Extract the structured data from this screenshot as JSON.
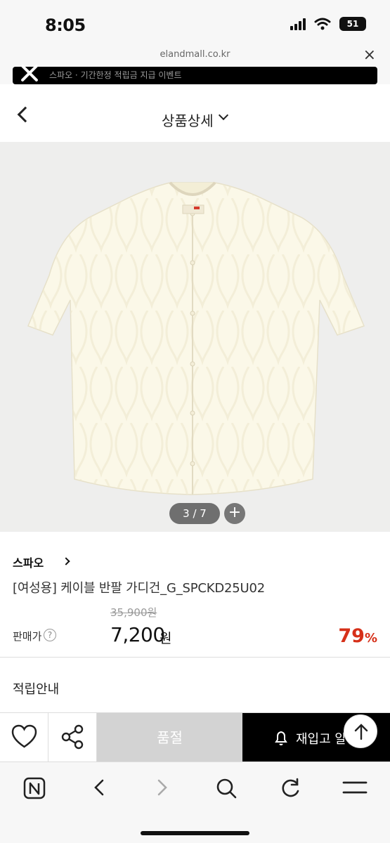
{
  "status_bar": {
    "time": "8:05",
    "battery": "51"
  },
  "browser": {
    "url": "elandmall.co.kr",
    "close_label": "×"
  },
  "notice": {
    "text": "스파오 · 기간한정 적립금 지급 이벤트"
  },
  "header": {
    "title": "상품상세"
  },
  "gallery": {
    "counter": "3 / 7",
    "plus_label": "+"
  },
  "product": {
    "brand": "스파오",
    "name": "[여성용] 케이블 반팔 가디건_G_SPCKD25U02",
    "sale_label": "판매가",
    "help_label": "?",
    "original_price": "35,900원",
    "price": "7,200",
    "currency": "원",
    "discount": "79",
    "discount_unit": "%",
    "point_info_label": "적립안내"
  },
  "actions": {
    "soldout_label": "품절",
    "restock_label": "재입고 알림"
  },
  "icons": {
    "wish": "heart-icon",
    "share": "share-icon",
    "bell": "bell-icon",
    "top": "arrow-up-icon",
    "home": "naver-home-icon",
    "back": "chevron-left-icon",
    "forward": "chevron-right-icon",
    "search": "search-icon",
    "refresh": "refresh-icon",
    "menu": "menu-icon"
  },
  "colors": {
    "discount": "#d63019",
    "restock_bg": "#000000",
    "soldout_bg": "#d3d3d3",
    "cardigan": "#fbf8e8"
  }
}
